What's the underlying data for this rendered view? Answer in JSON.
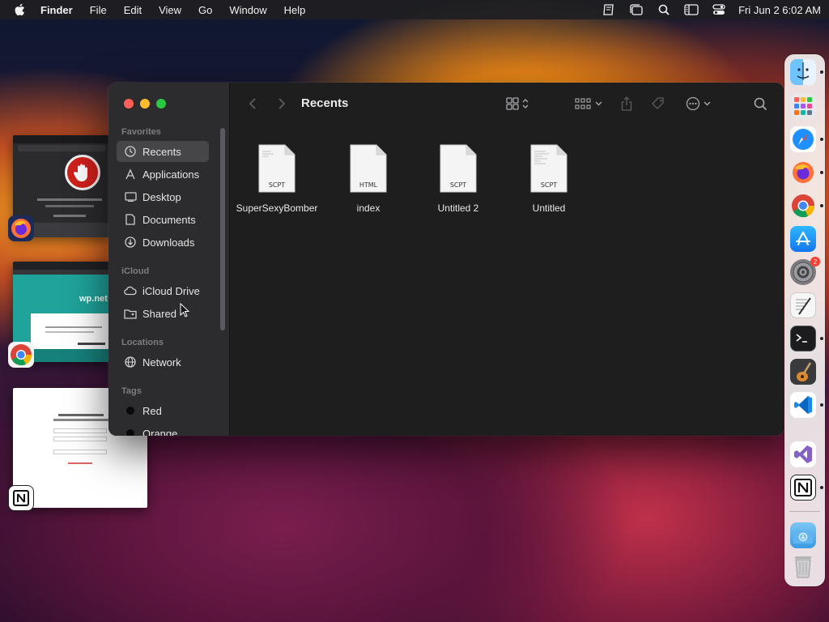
{
  "menubar": {
    "app_name": "Finder",
    "menus": [
      "File",
      "Edit",
      "View",
      "Go",
      "Window",
      "Help"
    ],
    "clock": "Fri Jun 2  6:02 AM"
  },
  "finder": {
    "title": "Recents",
    "sidebar": {
      "favorites_header": "Favorites",
      "favorites": [
        "Recents",
        "Applications",
        "Desktop",
        "Documents",
        "Downloads"
      ],
      "icloud_header": "iCloud",
      "icloud": [
        "iCloud Drive",
        "Shared"
      ],
      "locations_header": "Locations",
      "locations": [
        "Network"
      ],
      "tags_header": "Tags",
      "tags": [
        "Red",
        "Orange"
      ]
    },
    "files": [
      {
        "name": "SuperSexyBomber",
        "type": "SCPT"
      },
      {
        "name": "index",
        "type": "HTML"
      },
      {
        "name": "Untitled 2",
        "type": "SCPT"
      },
      {
        "name": "Untitled",
        "type": "SCPT"
      }
    ]
  },
  "thumbnails": {
    "thumb2_heading": "wp.net"
  },
  "dock": {
    "apps": [
      "finder",
      "launchpad",
      "safari",
      "firefox",
      "chrome",
      "app-store",
      "system-settings",
      "textedit",
      "terminal",
      "garageband",
      "vscode",
      "visual-studio",
      "notion",
      "downloads-folder",
      "trash"
    ],
    "settings_badge": "2"
  }
}
